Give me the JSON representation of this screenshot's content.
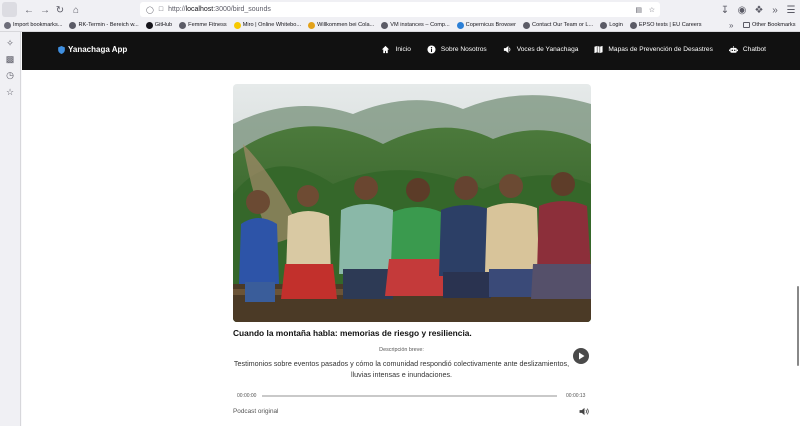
{
  "browser": {
    "url_prefix": "http://",
    "url_host": "localhost",
    "url_path": ":3000/bird_sounds",
    "bookmarks": [
      {
        "label": "Import bookmarks...",
        "color": "#6d6d7a"
      },
      {
        "label": "RK-Termin - Bereich w...",
        "color": "#5b5b66"
      },
      {
        "label": "GitHub",
        "color": "#15141a"
      },
      {
        "label": "Femme Fitness",
        "color": "#5b5b66"
      },
      {
        "label": "Miro | Online Whitebo...",
        "color": "#f7c900"
      },
      {
        "label": "Willkommen bei Cola...",
        "color": "#e3a21a"
      },
      {
        "label": "VM instances – Comp...",
        "color": "#5b5b66"
      },
      {
        "label": "Copernicus Browser",
        "color": "#2b7fd6"
      },
      {
        "label": "Contact Our Team or L...",
        "color": "#5b5b66"
      },
      {
        "label": "Login",
        "color": "#5b5b66"
      },
      {
        "label": "EPSO tests | EU Careers",
        "color": "#5b5b66"
      }
    ],
    "other_bookmarks": "Other Bookmarks"
  },
  "navbar": {
    "brand": "Yanachaga App",
    "items": [
      {
        "label": "Inicio",
        "icon": "home-icon"
      },
      {
        "label": "Sobre Nosotros",
        "icon": "info-icon"
      },
      {
        "label": "Voces de Yanachaga",
        "icon": "speaker-icon"
      },
      {
        "label": "Mapas de Prevención de Desastres",
        "icon": "map-icon"
      },
      {
        "label": "Chatbot",
        "icon": "robot-icon"
      }
    ]
  },
  "card": {
    "title": "Cuando la montaña habla: memorias de riesgo y resiliencia.",
    "description_label": "Descripción breve:",
    "description": "Testimonios sobre eventos pasados y cómo la comunidad respondió colectivamente ante deslizamientos, lluvias intensas e inundaciones.",
    "time_current": "00:00:00",
    "time_total": "00:00:13",
    "podcast_label": "Podcast original"
  }
}
